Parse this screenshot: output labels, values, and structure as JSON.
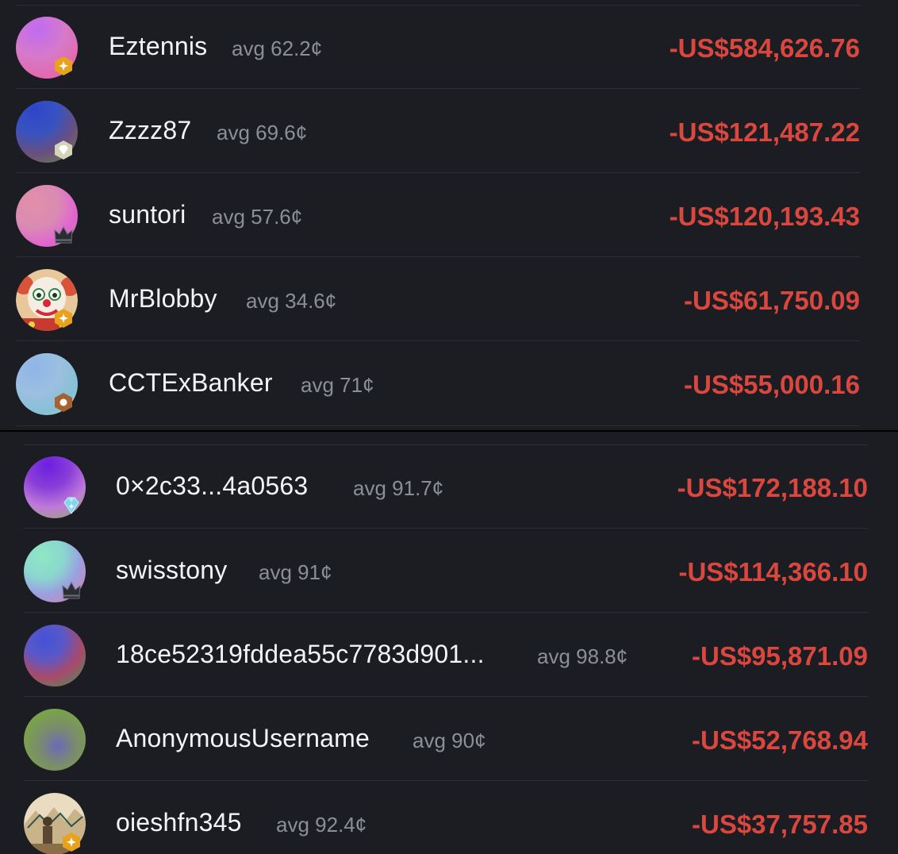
{
  "colors": {
    "panel_bg": "#1b1d22",
    "name_text": "#f3f4f6",
    "avg_text": "#8b8f98",
    "loss_red": "#d9473f",
    "divider": "#2c2f36"
  },
  "top_list": [
    {
      "name": "Eztennis",
      "avg": "avg 62.2¢",
      "amount": "-US$584,626.76",
      "badge": "gold-plus-badge-icon"
    },
    {
      "name": "Zzzz87",
      "avg": "avg 69.6¢",
      "amount": "-US$121,487.22",
      "badge": "silver-gem-badge-icon"
    },
    {
      "name": "suntori",
      "avg": "avg 57.6¢",
      "amount": "-US$120,193.43",
      "badge": "crown-badge-icon"
    },
    {
      "name": "MrBlobby",
      "avg": "avg 34.6¢",
      "amount": "-US$61,750.09",
      "badge": "gold-plus-badge-icon"
    },
    {
      "name": "CCTExBanker",
      "avg": "avg 71¢",
      "amount": "-US$55,000.16",
      "badge": "bronze-badge-icon"
    }
  ],
  "bottom_list": [
    {
      "name": "0×2c33...4a0563",
      "avg": "avg 91.7¢",
      "amount": "-US$172,188.10",
      "badge": "diamond-badge-icon"
    },
    {
      "name": "swisstony",
      "avg": "avg 91¢",
      "amount": "-US$114,366.10",
      "badge": "crown-badge-icon"
    },
    {
      "name": "18ce52319fddea55c7783d901...",
      "avg": "avg 98.8¢",
      "amount": "-US$95,871.09",
      "badge": ""
    },
    {
      "name": "AnonymousUsername",
      "avg": "avg 90¢",
      "amount": "-US$52,768.94",
      "badge": ""
    },
    {
      "name": "oieshfn345",
      "avg": "avg 92.4¢",
      "amount": "-US$37,757.85",
      "badge": "gold-plus-badge-icon"
    }
  ]
}
